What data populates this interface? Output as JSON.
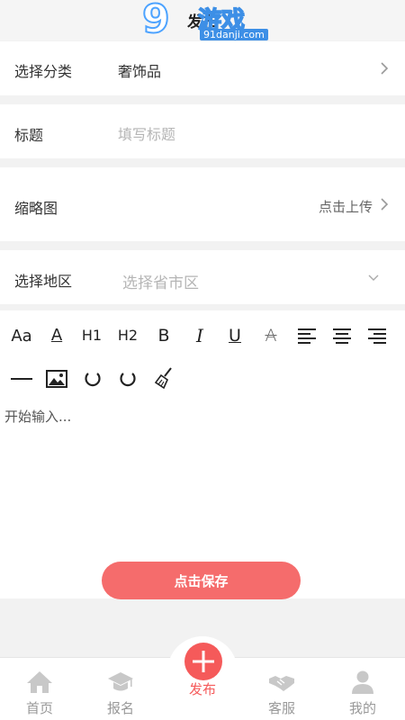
{
  "header": {
    "title": "发布"
  },
  "watermark": {
    "brand": "9",
    "game": "游戏",
    "url": "91danji.com"
  },
  "form": {
    "category": {
      "label": "选择分类",
      "value": "奢饰品"
    },
    "title": {
      "label": "标题",
      "placeholder": "填写标题"
    },
    "thumbnail": {
      "label": "缩略图",
      "action": "点击上传"
    },
    "region": {
      "label": "选择地区",
      "placeholder": "选择省市区"
    }
  },
  "toolbar": {
    "font_size": "Aa",
    "font_color": "A",
    "h1": "H1",
    "h2": "H2",
    "bold": "B",
    "italic": "I",
    "underline": "U",
    "strike": "A"
  },
  "editor": {
    "placeholder": "开始输入..."
  },
  "save_button": {
    "label": "点击保存"
  },
  "tabbar": {
    "home": "首页",
    "signup": "报名",
    "publish": "发布",
    "service": "客服",
    "mine": "我的"
  },
  "colors": {
    "accent": "#f55a5a",
    "save": "#f56c6c",
    "muted": "#999999"
  }
}
